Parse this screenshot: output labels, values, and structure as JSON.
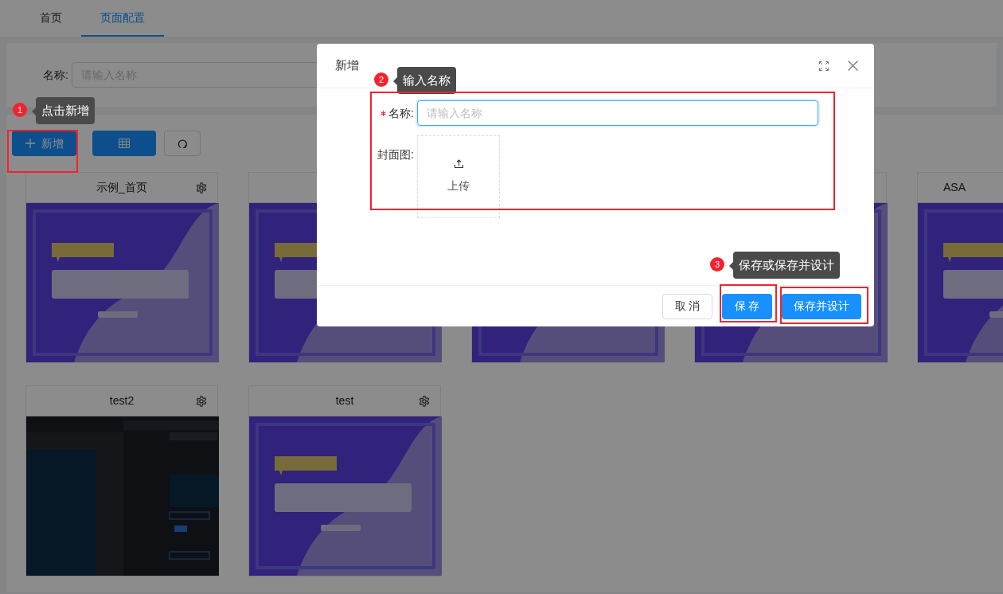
{
  "tabs": [
    {
      "label": "首页",
      "selected": false
    },
    {
      "label": "页面配置",
      "selected": true
    }
  ],
  "search": {
    "label": "名称:",
    "placeholder": "请输入名称"
  },
  "toolbar": {
    "add_button": "新增"
  },
  "cards": [
    {
      "title": "示例_首页",
      "settings": true,
      "kind": "banner"
    },
    {
      "kind": "banner"
    },
    {
      "kind": "banner"
    },
    {
      "kind": "banner"
    },
    {
      "title": "ASA",
      "settings": false,
      "kind": "banner"
    },
    {
      "title": "test2",
      "settings": true,
      "kind": "dark"
    },
    {
      "title": "test",
      "settings": true,
      "kind": "banner"
    }
  ],
  "dialog": {
    "title": "新增",
    "fields": [
      {
        "label": "名称:",
        "required": true,
        "kind": "text",
        "placeholder": "请输入名称"
      },
      {
        "label": "封面图:",
        "required": false,
        "kind": "upload",
        "button": "上传"
      }
    ],
    "buttons": [
      {
        "label": "取 消",
        "primary": false
      },
      {
        "label": "保 存",
        "primary": true
      },
      {
        "label": "保存并设计",
        "primary": true
      }
    ]
  },
  "guide_steps": [
    {
      "number": "1",
      "text": "点击新增"
    },
    {
      "number": "2",
      "text": "输入名称"
    },
    {
      "number": "3",
      "text": "保存或保存并设计"
    }
  ]
}
